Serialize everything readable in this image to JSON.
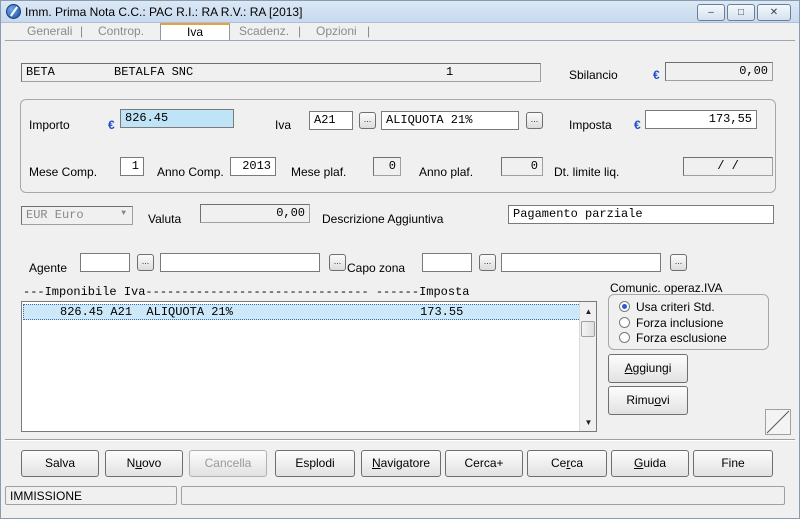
{
  "window": {
    "title": "Imm. Prima Nota C.C.: PAC  R.I.: RA  R.V.: RA  [2013]",
    "controls": {
      "minimize": "–",
      "maximize": "□",
      "close": "✕"
    }
  },
  "tabs": [
    {
      "label": "Generali"
    },
    {
      "label": "Controp."
    },
    {
      "label": "Iva"
    },
    {
      "label": "Scadenz."
    },
    {
      "label": "Opzioni"
    }
  ],
  "tab_separators": "|",
  "header": {
    "code": "BETA",
    "name": "BETALFA SNC",
    "number": "1",
    "sbilancio_label": "Sbilancio",
    "currency_symbol": "€",
    "sbilancio_value": "0,00"
  },
  "iva_group": {
    "importo_label": "Importo",
    "importo_value": "826.45",
    "iva_label": "Iva",
    "iva_code": "A21",
    "iva_desc": "ALIQUOTA 21%",
    "imposta_label": "Imposta",
    "imposta_value": "173,55",
    "mese_comp_label": "Mese Comp.",
    "mese_comp_value": "1",
    "anno_comp_label": "Anno Comp.",
    "anno_comp_value": "2013",
    "mese_plaf_label": "Mese plaf.",
    "mese_plaf_value": "0",
    "anno_plaf_label": "Anno plaf.",
    "anno_plaf_value": "0",
    "dt_limite_label": "Dt. limite liq.",
    "dt_limite_value": "/  /"
  },
  "valuta": {
    "currency_select": "EUR Euro",
    "label": "Valuta",
    "value": "0,00",
    "desc_label": "Descrizione Aggiuntiva",
    "desc_value": "Pagamento parziale"
  },
  "agente": {
    "label": "Agente",
    "capo_zona_label": "Capo zona",
    "dots": "..."
  },
  "list": {
    "header": "---Imponibile Iva------------------------------- ------Imposta",
    "rows": [
      {
        "text": "     826.45 A21  ALIQUOTA 21%                          173.55"
      }
    ]
  },
  "comunic": {
    "title": "Comunic. operaz.IVA",
    "options": [
      "Usa criteri Std.",
      "Forza inclusione",
      "Forza esclusione"
    ],
    "selected": "Usa criteri Std."
  },
  "side_buttons": {
    "aggiungi": {
      "pre": "",
      "u": "A",
      "post": "ggiungi"
    },
    "rimuovi": {
      "pre": "Rimu",
      "u": "o",
      "post": "vi"
    }
  },
  "buttons": {
    "salva": {
      "pre": "Salva",
      "u": "",
      "post": ""
    },
    "nuovo": {
      "pre": "N",
      "u": "u",
      "post": "ovo"
    },
    "cancella": {
      "pre": "Cancella",
      "u": "",
      "post": ""
    },
    "esplodi": {
      "pre": "Esplodi",
      "u": "",
      "post": ""
    },
    "navigatore": {
      "pre": "",
      "u": "N",
      "post": "avigatore"
    },
    "cerca_plus": {
      "pre": "Cerca+",
      "u": "",
      "post": ""
    },
    "cerca": {
      "pre": "Ce",
      "u": "r",
      "post": "ca"
    },
    "guida": {
      "pre": "",
      "u": "G",
      "post": "uida"
    },
    "fine": {
      "pre": "Fine",
      "u": "",
      "post": ""
    }
  },
  "status": {
    "mode": "IMMISSIONE",
    "message": ""
  },
  "scroll": {
    "up": "▲",
    "down": "▼"
  }
}
